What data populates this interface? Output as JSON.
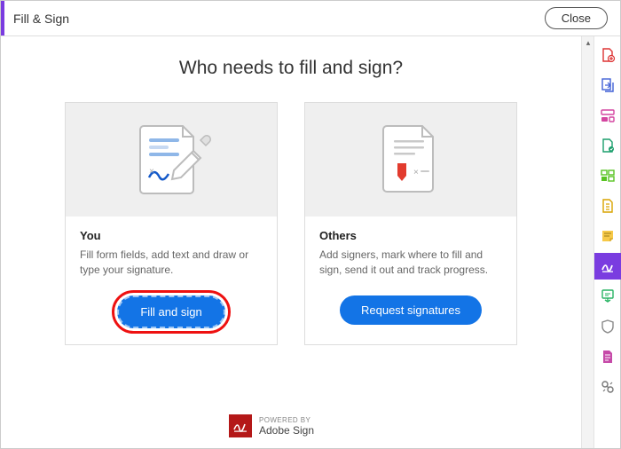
{
  "header": {
    "title": "Fill & Sign",
    "close_label": "Close"
  },
  "page": {
    "heading": "Who needs to fill and sign?"
  },
  "cards": {
    "you": {
      "title": "You",
      "desc": "Fill form fields, add text and draw or type your signature.",
      "cta": "Fill and sign"
    },
    "others": {
      "title": "Others",
      "desc": "Add signers, mark where to fill and sign, send it out and track progress.",
      "cta": "Request signatures"
    }
  },
  "footer": {
    "powered": "POWERED BY",
    "brand": "Adobe Sign"
  },
  "rail": {
    "active_index": 7
  }
}
